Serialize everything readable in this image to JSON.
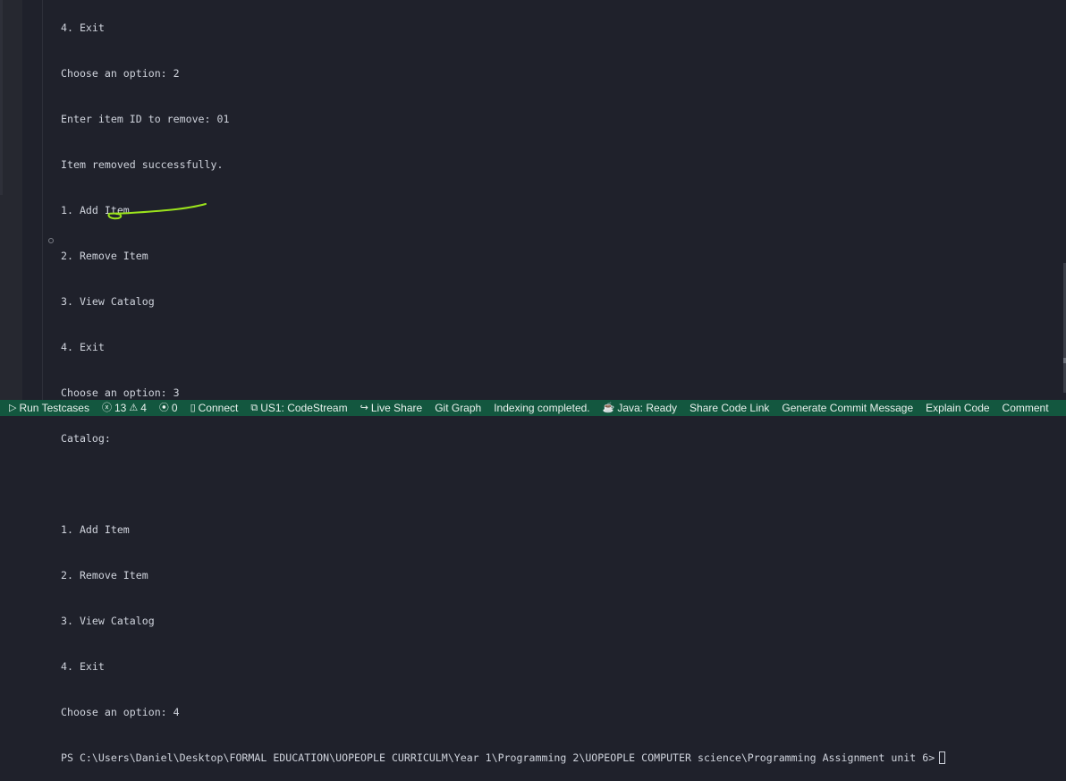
{
  "terminal": {
    "lines": [
      "4. Exit",
      "Choose an option: 2",
      "Enter item ID to remove: 01",
      "Item removed successfully.",
      "1. Add Item",
      "2. Remove Item",
      "3. View Catalog",
      "4. Exit",
      "Choose an option: 3",
      "Catalog:",
      "",
      "1. Add Item",
      "2. Remove Item",
      "3. View Catalog",
      "4. Exit",
      "Choose an option: 4"
    ],
    "prompt": "PS C:\\Users\\Daniel\\Desktop\\FORMAL EDUCATION\\UOPEOPLE CURRICULM\\Year 1\\Programming 2\\UOPEOPLE COMPUTER science\\Programming Assignment unit 6>"
  },
  "statusbar": {
    "run_testcases": "Run Testcases",
    "errors": "13",
    "warnings": "4",
    "ports": "0",
    "connect": "Connect",
    "codestream": "US1: CodeStream",
    "live_share": "Live Share",
    "git_graph": "Git Graph",
    "indexing": "Indexing completed.",
    "java": "Java: Ready",
    "share_code_link": "Share Code Link",
    "generate_commit": "Generate Commit Message",
    "explain_code": "Explain Code",
    "comment": "Comment"
  },
  "colors": {
    "background": "#1f212b",
    "statusbar": "#13573f",
    "annotation": "#9be31c"
  }
}
